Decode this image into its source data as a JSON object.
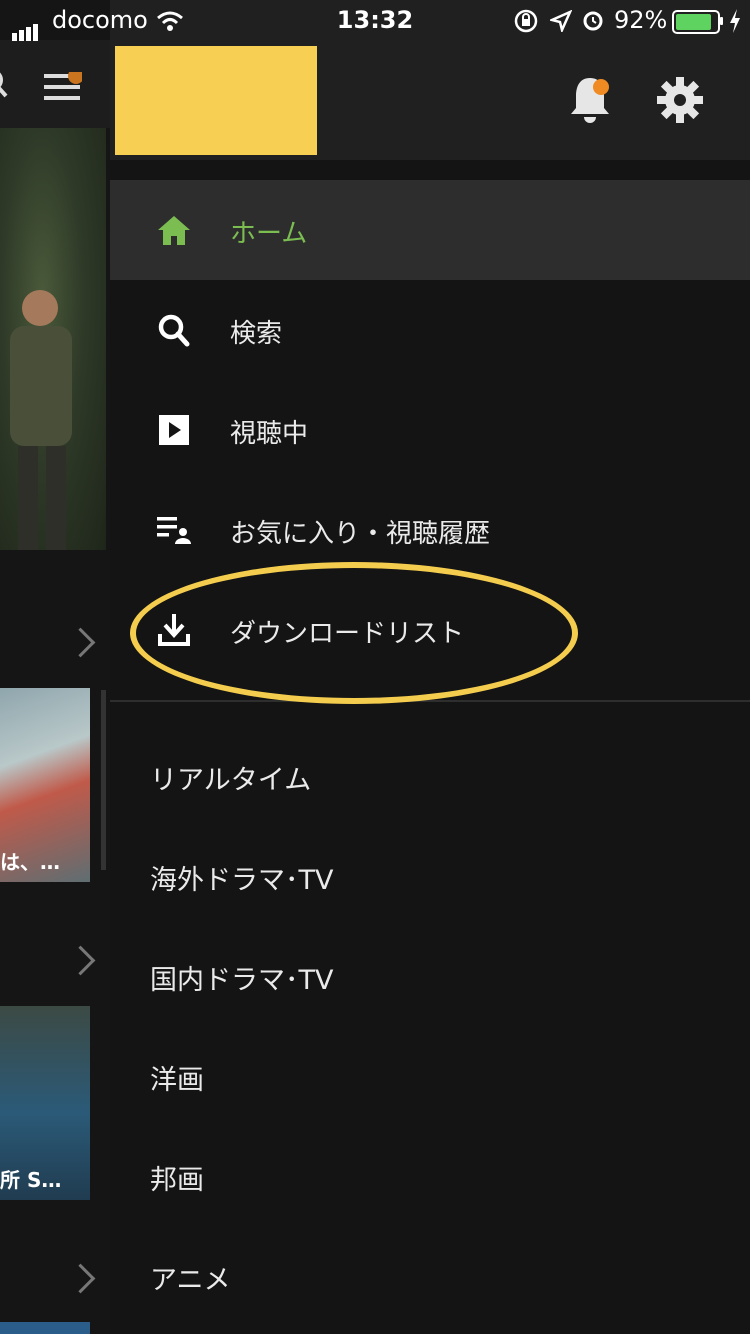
{
  "status_bar": {
    "carrier": "docomo",
    "time": "13:32",
    "battery_percent": "92%",
    "battery_level": 0.92
  },
  "background": {
    "captions": [
      "は、…",
      "所 S…"
    ]
  },
  "drawer": {
    "notifications": {
      "has_badge": true,
      "badge_color": "#f08a22"
    },
    "menu": [
      {
        "label": "ホーム",
        "icon": "home-icon",
        "active": true
      },
      {
        "label": "検索",
        "icon": "search-icon",
        "active": false
      },
      {
        "label": "視聴中",
        "icon": "play-icon",
        "active": false
      },
      {
        "label": "お気に入り・視聴履歴",
        "icon": "favorites-list-icon",
        "active": false
      },
      {
        "label": "ダウンロードリスト",
        "icon": "download-icon",
        "active": false,
        "highlighted": true
      }
    ],
    "categories": [
      {
        "label": "リアルタイム"
      },
      {
        "label": "海外ドラマ･TV"
      },
      {
        "label": "国内ドラマ･TV"
      },
      {
        "label": "洋画"
      },
      {
        "label": "邦画"
      },
      {
        "label": "アニメ"
      }
    ]
  },
  "colors": {
    "accent_green": "#7cbd52",
    "logo_yellow": "#f7d053",
    "highlight_ring": "#f4cd4e"
  }
}
